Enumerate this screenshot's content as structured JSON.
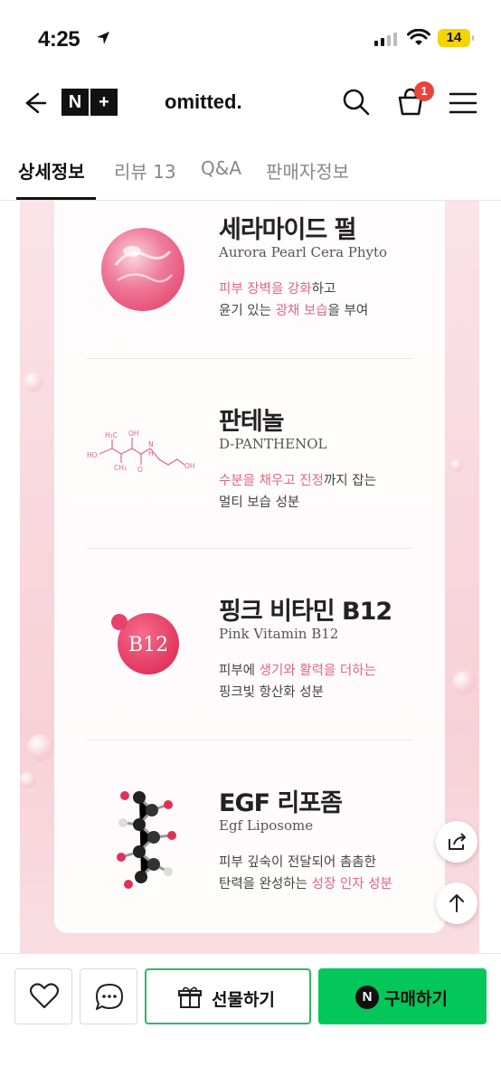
{
  "status_bar": {
    "time": "4:25",
    "battery": "14"
  },
  "header": {
    "brand": "omitted.",
    "logo_left": "N",
    "logo_right": "+",
    "cart_count": "1"
  },
  "tabs": [
    {
      "label": "상세정보",
      "active": true
    },
    {
      "label": "리뷰 13",
      "active": false
    },
    {
      "label": "Q&A",
      "active": false
    },
    {
      "label": "판매자정보",
      "active": false
    }
  ],
  "ingredients": [
    {
      "name": "세라마이드 펄",
      "subtitle": "Aurora Pearl Cera Phyto",
      "desc_line1": [
        {
          "t": "피부 장벽을 강화",
          "hl": true
        },
        {
          "t": "하고",
          "hl": false
        }
      ],
      "desc_line2": [
        {
          "t": "윤기 있는 ",
          "hl": false
        },
        {
          "t": "광채 보습",
          "hl": true
        },
        {
          "t": "을 부여",
          "hl": false
        }
      ],
      "icon": "pearl-icon"
    },
    {
      "name": "판테놀",
      "subtitle": "D-PANTHENOL",
      "desc_line1": [
        {
          "t": "수분을 채우고 진정",
          "hl": true
        },
        {
          "t": "까지 잡는",
          "hl": false
        }
      ],
      "desc_line2": [
        {
          "t": "멀티 보습 성분",
          "hl": false
        }
      ],
      "icon": "molecule-structure-icon",
      "molecule_labels": [
        "H₃C",
        "OH",
        "HO",
        "CH₃",
        "O",
        "N",
        "H",
        "OH"
      ]
    },
    {
      "name": "핑크 비타민 B12",
      "subtitle": "Pink Vitamin B12",
      "desc_line1": [
        {
          "t": "피부에 ",
          "hl": false
        },
        {
          "t": "생기와 활력을 더하는",
          "hl": true
        }
      ],
      "desc_line2": [
        {
          "t": "핑크빛 항산화 성분",
          "hl": false
        }
      ],
      "icon": "vitamin-b12-icon",
      "badge_text": "B12"
    },
    {
      "name": "EGF 리포좀",
      "subtitle": "Egf Liposome",
      "desc_line1": [
        {
          "t": "피부 깊숙이 전달되어 촘촘한",
          "hl": false
        }
      ],
      "desc_line2": [
        {
          "t": "탄력을 완성하는 ",
          "hl": false
        },
        {
          "t": "성장 인자 성분",
          "hl": true
        }
      ],
      "icon": "molecule-model-icon"
    }
  ],
  "bottom_bar": {
    "gift_label": "선물하기",
    "buy_label": "구매하기",
    "npay_mark": "N"
  },
  "colors": {
    "highlight": "#e06684",
    "pink_bg": "#f8d7dd",
    "buy_green": "#03c75a",
    "badge_red": "#e8443a"
  }
}
